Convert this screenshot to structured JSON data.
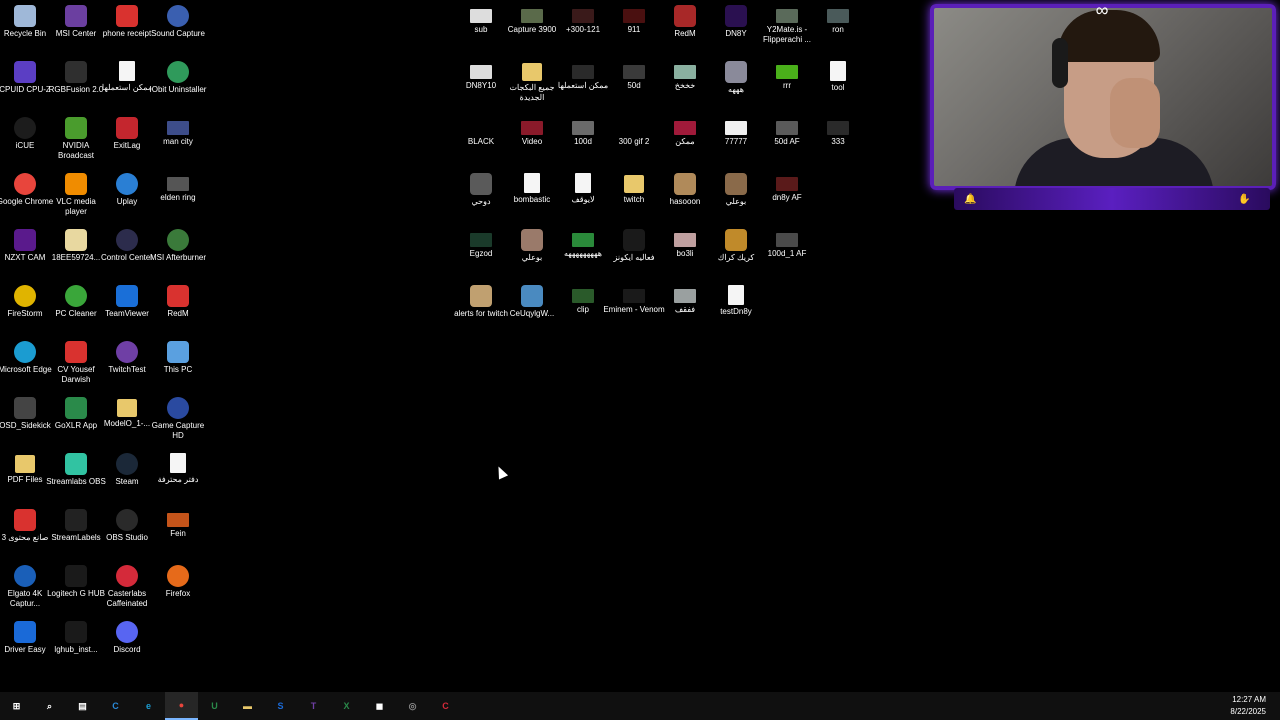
{
  "desktop_icons": [
    {
      "label": "Recycle Bin",
      "icon": "recycle-bin-icon",
      "color": "#9fb8d8",
      "kind": "std",
      "col": 0,
      "row": 0
    },
    {
      "label": "MSI Center",
      "icon": "msi-center-icon",
      "color": "#6b3fa0",
      "kind": "std",
      "col": 1,
      "row": 0
    },
    {
      "label": "phone receipt",
      "icon": "pdf-icon",
      "color": "#d9322f",
      "kind": "std",
      "col": 2,
      "row": 0
    },
    {
      "label": "Sound Capture",
      "icon": "sound-capture-icon",
      "color": "#3a5fb0",
      "kind": "round",
      "col": 3,
      "row": 0
    },
    {
      "label": "CPUID CPU-Z",
      "icon": "cpu-z-icon",
      "color": "#5b3ec4",
      "kind": "std",
      "col": 0,
      "row": 1
    },
    {
      "label": "RGBFusion 2.0",
      "icon": "rgbfusion-icon",
      "color": "#2f2f2f",
      "kind": "std",
      "col": 1,
      "row": 1
    },
    {
      "label": "ممكن استعملها",
      "icon": "document-icon",
      "color": "#f5f5f5",
      "kind": "doc",
      "col": 2,
      "row": 1
    },
    {
      "label": "IObit Uninstaller",
      "icon": "iobit-icon",
      "color": "#2f9a5b",
      "kind": "round",
      "col": 3,
      "row": 1
    },
    {
      "label": "iCUE",
      "icon": "icue-icon",
      "color": "#1c1c1c",
      "kind": "round",
      "col": 0,
      "row": 2
    },
    {
      "label": "NVIDIA Broadcast",
      "icon": "nvidia-broadcast-icon",
      "color": "#4a9c2d",
      "kind": "std",
      "col": 1,
      "row": 2
    },
    {
      "label": "ExitLag",
      "icon": "exitlag-icon",
      "color": "#c4262e",
      "kind": "std",
      "col": 2,
      "row": 2
    },
    {
      "label": "man city",
      "icon": "shortcut-icon",
      "color": "#3d4d8a",
      "kind": "thumb",
      "col": 3,
      "row": 2
    },
    {
      "label": "Google Chrome",
      "icon": "chrome-icon",
      "color": "#e8453c",
      "kind": "round",
      "col": 0,
      "row": 3
    },
    {
      "label": "VLC media player",
      "icon": "vlc-icon",
      "color": "#f08c00",
      "kind": "std",
      "col": 1,
      "row": 3
    },
    {
      "label": "Uplay",
      "icon": "uplay-icon",
      "color": "#2a7fd4",
      "kind": "round",
      "col": 2,
      "row": 3
    },
    {
      "label": "elden ring",
      "icon": "shortcut-icon",
      "color": "#555555",
      "kind": "thumb",
      "col": 3,
      "row": 3
    },
    {
      "label": "NZXT CAM",
      "icon": "nzxt-icon",
      "color": "#5a1a8c",
      "kind": "std",
      "col": 0,
      "row": 4
    },
    {
      "label": "18EE59724...",
      "icon": "file-icon",
      "color": "#e8d8a0",
      "kind": "std",
      "col": 1,
      "row": 4
    },
    {
      "label": "Control Center",
      "icon": "control-center-icon",
      "color": "#2c2c4c",
      "kind": "round",
      "col": 2,
      "row": 4
    },
    {
      "label": "MSI Afterburner",
      "icon": "afterburner-icon",
      "color": "#3a7a3a",
      "kind": "round",
      "col": 3,
      "row": 4
    },
    {
      "label": "FireStorm",
      "icon": "firestorm-icon",
      "color": "#e0b400",
      "kind": "round",
      "col": 0,
      "row": 5
    },
    {
      "label": "PC Cleaner",
      "icon": "pc-cleaner-icon",
      "color": "#3aa63a",
      "kind": "round",
      "col": 1,
      "row": 5
    },
    {
      "label": "TeamViewer",
      "icon": "teamviewer-icon",
      "color": "#1a6fd8",
      "kind": "std",
      "col": 2,
      "row": 5
    },
    {
      "label": "RedM",
      "icon": "pdf-icon",
      "color": "#d9322f",
      "kind": "std",
      "col": 3,
      "row": 5
    },
    {
      "label": "Microsoft Edge",
      "icon": "edge-icon",
      "color": "#1b9cd1",
      "kind": "round",
      "col": 0,
      "row": 6
    },
    {
      "label": "CV Yousef Darwish",
      "icon": "pdf-icon",
      "color": "#d9322f",
      "kind": "std",
      "col": 1,
      "row": 6
    },
    {
      "label": "TwitchTest",
      "icon": "twitchtest-icon",
      "color": "#6f3fa5",
      "kind": "round",
      "col": 2,
      "row": 6
    },
    {
      "label": "This PC",
      "icon": "this-pc-icon",
      "color": "#5aa0e0",
      "kind": "std",
      "col": 3,
      "row": 6
    },
    {
      "label": "OSD_Sidekick",
      "icon": "osd-sidekick-icon",
      "color": "#444444",
      "kind": "std",
      "col": 0,
      "row": 7
    },
    {
      "label": "GoXLR App",
      "icon": "goxlr-icon",
      "color": "#2a8a4a",
      "kind": "std",
      "col": 1,
      "row": 7
    },
    {
      "label": "ModelO_1-...",
      "icon": "folder-icon",
      "color": "#e8c86b",
      "kind": "folder",
      "col": 2,
      "row": 7
    },
    {
      "label": "Game Capture HD",
      "icon": "game-capture-icon",
      "color": "#2a4aa0",
      "kind": "round",
      "col": 3,
      "row": 7
    },
    {
      "label": "PDF Files",
      "icon": "folder-icon",
      "color": "#e8c86b",
      "kind": "folder",
      "col": 0,
      "row": 8
    },
    {
      "label": "Streamlabs OBS",
      "icon": "streamlabs-icon",
      "color": "#31c3a2",
      "kind": "std",
      "col": 1,
      "row": 8
    },
    {
      "label": "Steam",
      "icon": "steam-icon",
      "color": "#1b2838",
      "kind": "round",
      "col": 2,
      "row": 8
    },
    {
      "label": "دفتر محترفة",
      "icon": "document-icon",
      "color": "#f5f5f5",
      "kind": "doc",
      "col": 3,
      "row": 8
    },
    {
      "label": "صانع محتوى 3",
      "icon": "pdf-icon",
      "color": "#d9322f",
      "kind": "std",
      "col": 0,
      "row": 9
    },
    {
      "label": "StreamLabels",
      "icon": "streamlabels-icon",
      "color": "#222222",
      "kind": "std",
      "col": 1,
      "row": 9
    },
    {
      "label": "OBS Studio",
      "icon": "obs-icon",
      "color": "#2a2a2a",
      "kind": "round",
      "col": 2,
      "row": 9
    },
    {
      "label": "Fein",
      "icon": "shortcut-icon",
      "color": "#c4541a",
      "kind": "thumb",
      "col": 3,
      "row": 9
    },
    {
      "label": "Elgato 4K Captur...",
      "icon": "elgato-icon",
      "color": "#1a5fb8",
      "kind": "round",
      "col": 0,
      "row": 10
    },
    {
      "label": "Logitech G HUB",
      "icon": "logitech-icon",
      "color": "#1a1a1a",
      "kind": "std",
      "col": 1,
      "row": 10
    },
    {
      "label": "Casterlabs Caffeinated",
      "icon": "casterlabs-icon",
      "color": "#d42a3a",
      "kind": "round",
      "col": 2,
      "row": 10
    },
    {
      "label": "Firefox",
      "icon": "firefox-icon",
      "color": "#e66a1a",
      "kind": "round",
      "col": 3,
      "row": 10
    },
    {
      "label": "Driver Easy",
      "icon": "driver-easy-icon",
      "color": "#1a6ad8",
      "kind": "std",
      "col": 0,
      "row": 11
    },
    {
      "label": "lghub_inst...",
      "icon": "logitech-installer-icon",
      "color": "#1a1a1a",
      "kind": "std",
      "col": 1,
      "row": 11
    },
    {
      "label": "Discord",
      "icon": "discord-icon",
      "color": "#5865f2",
      "kind": "round",
      "col": 2,
      "row": 11
    }
  ],
  "file_icons": [
    {
      "label": "sub",
      "icon": "file-icon",
      "color": "#dddddd",
      "kind": "thumb",
      "col": 0,
      "row": 0
    },
    {
      "label": "Capture 3900",
      "icon": "image-icon",
      "color": "#5a6a4a",
      "kind": "thumb",
      "col": 1,
      "row": 0
    },
    {
      "label": "+300-121",
      "icon": "image-icon",
      "color": "#3a1a1a",
      "kind": "thumb",
      "col": 2,
      "row": 0
    },
    {
      "label": "911",
      "icon": "image-icon",
      "color": "#4a1010",
      "kind": "thumb",
      "col": 3,
      "row": 0
    },
    {
      "label": "RedM",
      "icon": "image-icon",
      "color": "#a82828",
      "kind": "std",
      "col": 4,
      "row": 0
    },
    {
      "label": "DN8Y",
      "icon": "image-icon",
      "color": "#2a1050",
      "kind": "std",
      "col": 5,
      "row": 0
    },
    {
      "label": "Y2Mate.is - Flipperachi ...",
      "icon": "video-icon",
      "color": "#5a6a5a",
      "kind": "thumb",
      "col": 6,
      "row": 0
    },
    {
      "label": "ron",
      "icon": "image-icon",
      "color": "#4a5a5a",
      "kind": "thumb",
      "col": 7,
      "row": 0
    },
    {
      "label": "DN8Y10",
      "icon": "image-icon",
      "color": "#dddddd",
      "kind": "thumb",
      "col": 0,
      "row": 1
    },
    {
      "label": "جميع البكجات الجديدة",
      "icon": "folder-icon",
      "color": "#e8c86b",
      "kind": "folder",
      "col": 1,
      "row": 1
    },
    {
      "label": "ممكن استعملها",
      "icon": "image-icon",
      "color": "#2a2a2a",
      "kind": "thumb",
      "col": 2,
      "row": 1
    },
    {
      "label": "50d",
      "icon": "image-icon",
      "color": "#3a3a3a",
      "kind": "thumb",
      "col": 3,
      "row": 1
    },
    {
      "label": "خخخخ",
      "icon": "image-icon",
      "color": "#8ab0a0",
      "kind": "thumb",
      "col": 4,
      "row": 1
    },
    {
      "label": "هههه",
      "icon": "image-icon",
      "color": "#8a8a9a",
      "kind": "std",
      "col": 5,
      "row": 1
    },
    {
      "label": "rrr",
      "icon": "image-icon",
      "color": "#4ab01a",
      "kind": "thumb",
      "col": 6,
      "row": 1
    },
    {
      "label": "tool",
      "icon": "document-icon",
      "color": "#f5f5f5",
      "kind": "doc",
      "col": 7,
      "row": 1
    },
    {
      "label": "BLACK",
      "icon": "image-icon",
      "color": "#000000",
      "kind": "thumb",
      "col": 0,
      "row": 2
    },
    {
      "label": "Video",
      "icon": "video-icon",
      "color": "#8a1a2a",
      "kind": "thumb",
      "col": 1,
      "row": 2
    },
    {
      "label": "100d",
      "icon": "image-icon",
      "color": "#6a6a6a",
      "kind": "thumb",
      "col": 2,
      "row": 2
    },
    {
      "label": "300 gif 2",
      "icon": "image-icon",
      "color": "#000000",
      "kind": "thumb",
      "col": 3,
      "row": 2
    },
    {
      "label": "ممكن",
      "icon": "image-icon",
      "color": "#a01a3a",
      "kind": "thumb",
      "col": 4,
      "row": 2
    },
    {
      "label": "77777",
      "icon": "image-icon",
      "color": "#f0f0f0",
      "kind": "thumb",
      "col": 5,
      "row": 2
    },
    {
      "label": "50d AF",
      "icon": "image-icon",
      "color": "#5a5a5a",
      "kind": "thumb",
      "col": 6,
      "row": 2
    },
    {
      "label": "333",
      "icon": "image-icon",
      "color": "#2a2a2a",
      "kind": "thumb",
      "col": 7,
      "row": 2
    },
    {
      "label": "دوحي",
      "icon": "image-icon",
      "color": "#5a5a5a",
      "kind": "std",
      "col": 0,
      "row": 3
    },
    {
      "label": "bombastic",
      "icon": "video-icon",
      "color": "#f5f5f5",
      "kind": "doc",
      "col": 1,
      "row": 3
    },
    {
      "label": "لايوقف",
      "icon": "video-icon",
      "color": "#f5f5f5",
      "kind": "doc",
      "col": 2,
      "row": 3
    },
    {
      "label": "twitch",
      "icon": "folder-icon",
      "color": "#e8c86b",
      "kind": "folder",
      "col": 3,
      "row": 3
    },
    {
      "label": "hasooon",
      "icon": "image-icon",
      "color": "#b08a5a",
      "kind": "std",
      "col": 4,
      "row": 3
    },
    {
      "label": "بوعلي",
      "icon": "image-icon",
      "color": "#8a6a4a",
      "kind": "std",
      "col": 5,
      "row": 3
    },
    {
      "label": "dn8y AF",
      "icon": "image-icon",
      "color": "#5a1a1a",
      "kind": "thumb",
      "col": 6,
      "row": 3
    },
    {
      "label": "Egzod",
      "icon": "image-icon",
      "color": "#1a3a2a",
      "kind": "thumb",
      "col": 0,
      "row": 4
    },
    {
      "label": "بوعلي",
      "icon": "image-icon",
      "color": "#9a7a6a",
      "kind": "std",
      "col": 1,
      "row": 4
    },
    {
      "label": "هههههههههه",
      "icon": "image-icon",
      "color": "#2a8a3a",
      "kind": "thumb",
      "col": 2,
      "row": 4
    },
    {
      "label": "فعاليه ايكونز",
      "icon": "image-icon",
      "color": "#1a1a1a",
      "kind": "std",
      "col": 3,
      "row": 4
    },
    {
      "label": "bo3li",
      "icon": "image-icon",
      "color": "#c0a0a0",
      "kind": "thumb",
      "col": 4,
      "row": 4
    },
    {
      "label": "كريك كراك",
      "icon": "image-icon",
      "color": "#c08a2a",
      "kind": "std",
      "col": 5,
      "row": 4
    },
    {
      "label": "100d_1 AF",
      "icon": "image-icon",
      "color": "#4a4a4a",
      "kind": "thumb",
      "col": 6,
      "row": 4
    },
    {
      "label": "alerts for twitch",
      "icon": "image-icon",
      "color": "#c0a070",
      "kind": "std",
      "col": 0,
      "row": 5
    },
    {
      "label": "CeUqylgW...",
      "icon": "image-icon",
      "color": "#4a8ac0",
      "kind": "std",
      "col": 1,
      "row": 5
    },
    {
      "label": "clip",
      "icon": "image-icon",
      "color": "#2a5a2a",
      "kind": "thumb",
      "col": 2,
      "row": 5
    },
    {
      "label": "Eminem - Venom",
      "icon": "image-icon",
      "color": "#1a1a1a",
      "kind": "thumb",
      "col": 3,
      "row": 5
    },
    {
      "label": "ففقف",
      "icon": "image-icon",
      "color": "#9aa0a0",
      "kind": "thumb",
      "col": 4,
      "row": 5
    },
    {
      "label": "testDn8y",
      "icon": "video-icon",
      "color": "#f5f5f5",
      "kind": "doc",
      "col": 5,
      "row": 5
    }
  ],
  "taskbar": {
    "items": [
      {
        "name": "start-button",
        "glyph": "⊞",
        "color": "#ffffff",
        "active": false
      },
      {
        "name": "search-button",
        "glyph": "⌕",
        "color": "#ffffff",
        "active": false
      },
      {
        "name": "task-view-button",
        "glyph": "▤",
        "color": "#ffffff",
        "active": false
      },
      {
        "name": "copilot-taskbar-icon",
        "glyph": "C",
        "color": "#2a8ad8",
        "active": false
      },
      {
        "name": "edge-taskbar-icon",
        "glyph": "e",
        "color": "#1b9cd1",
        "active": false
      },
      {
        "name": "chrome-taskbar-icon",
        "glyph": "●",
        "color": "#e8453c",
        "active": true
      },
      {
        "name": "uplay-taskbar-icon",
        "glyph": "U",
        "color": "#2a8a4a",
        "active": false
      },
      {
        "name": "file-explorer-taskbar-icon",
        "glyph": "▬",
        "color": "#e8c86b",
        "active": false
      },
      {
        "name": "streamlabs-taskbar-icon",
        "glyph": "S",
        "color": "#1a6ad8",
        "active": false
      },
      {
        "name": "twitchtest-taskbar-icon",
        "glyph": "T",
        "color": "#6f3fa5",
        "active": false
      },
      {
        "name": "goxlr-taskbar-icon",
        "glyph": "X",
        "color": "#2a8a4a",
        "active": false
      },
      {
        "name": "app-taskbar-icon",
        "glyph": "◼",
        "color": "#ffffff",
        "active": false
      },
      {
        "name": "obs-taskbar-icon",
        "glyph": "◎",
        "color": "#888888",
        "active": false
      },
      {
        "name": "casterlabs-taskbar-icon",
        "glyph": "C",
        "color": "#d42a3a",
        "active": false
      }
    ]
  },
  "clock": {
    "time": "12:27 AM",
    "date": "8/22/2025"
  },
  "webcam": {
    "accent_color": "#5b1fb8",
    "logo_icon": "infinity-logo-icon"
  }
}
